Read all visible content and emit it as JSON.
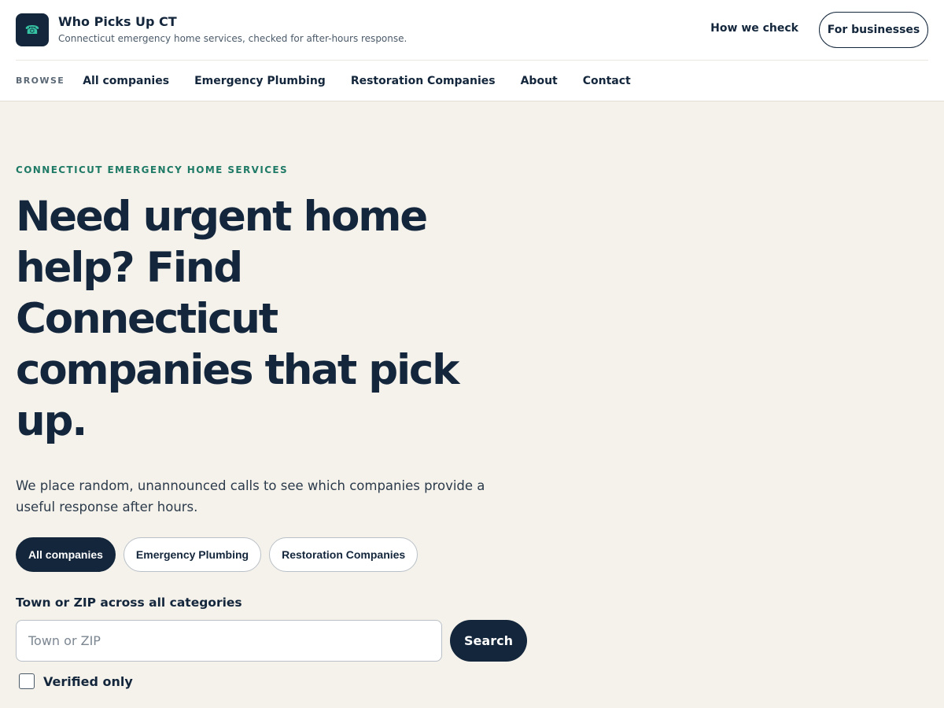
{
  "header": {
    "logo_icon": "telephone-icon",
    "logo_glyph": "☎",
    "title": "Who Picks Up CT",
    "tagline": "Connecticut emergency home services, checked for after-hours response.",
    "how_link": "How we check",
    "business_button": "For businesses"
  },
  "nav": {
    "browse_label": "BROWSE",
    "items": [
      {
        "label": "All companies"
      },
      {
        "label": "Emergency Plumbing"
      },
      {
        "label": "Restoration Companies"
      },
      {
        "label": "About"
      },
      {
        "label": "Contact"
      }
    ]
  },
  "hero": {
    "eyebrow": "CONNECTICUT EMERGENCY HOME SERVICES",
    "headline": "Need urgent home help? Find Connecticut companies that pick up.",
    "lede": "We place random, unannounced calls to see which companies provide a useful response after hours."
  },
  "filters": {
    "chips": [
      {
        "label": "All companies",
        "selected": true
      },
      {
        "label": "Emergency Plumbing",
        "selected": false
      },
      {
        "label": "Restoration Companies",
        "selected": false
      }
    ]
  },
  "search": {
    "label": "Town or ZIP across all categories",
    "placeholder": "Town or ZIP",
    "value": "",
    "button": "Search",
    "verified_label": "Verified only",
    "verified_checked": false
  },
  "colors": {
    "navy": "#13263b",
    "accent_green": "#1f7a66",
    "icon_teal": "#35c3a3",
    "page_bg": "#f5f2ec",
    "header_bg": "#ffffff"
  }
}
